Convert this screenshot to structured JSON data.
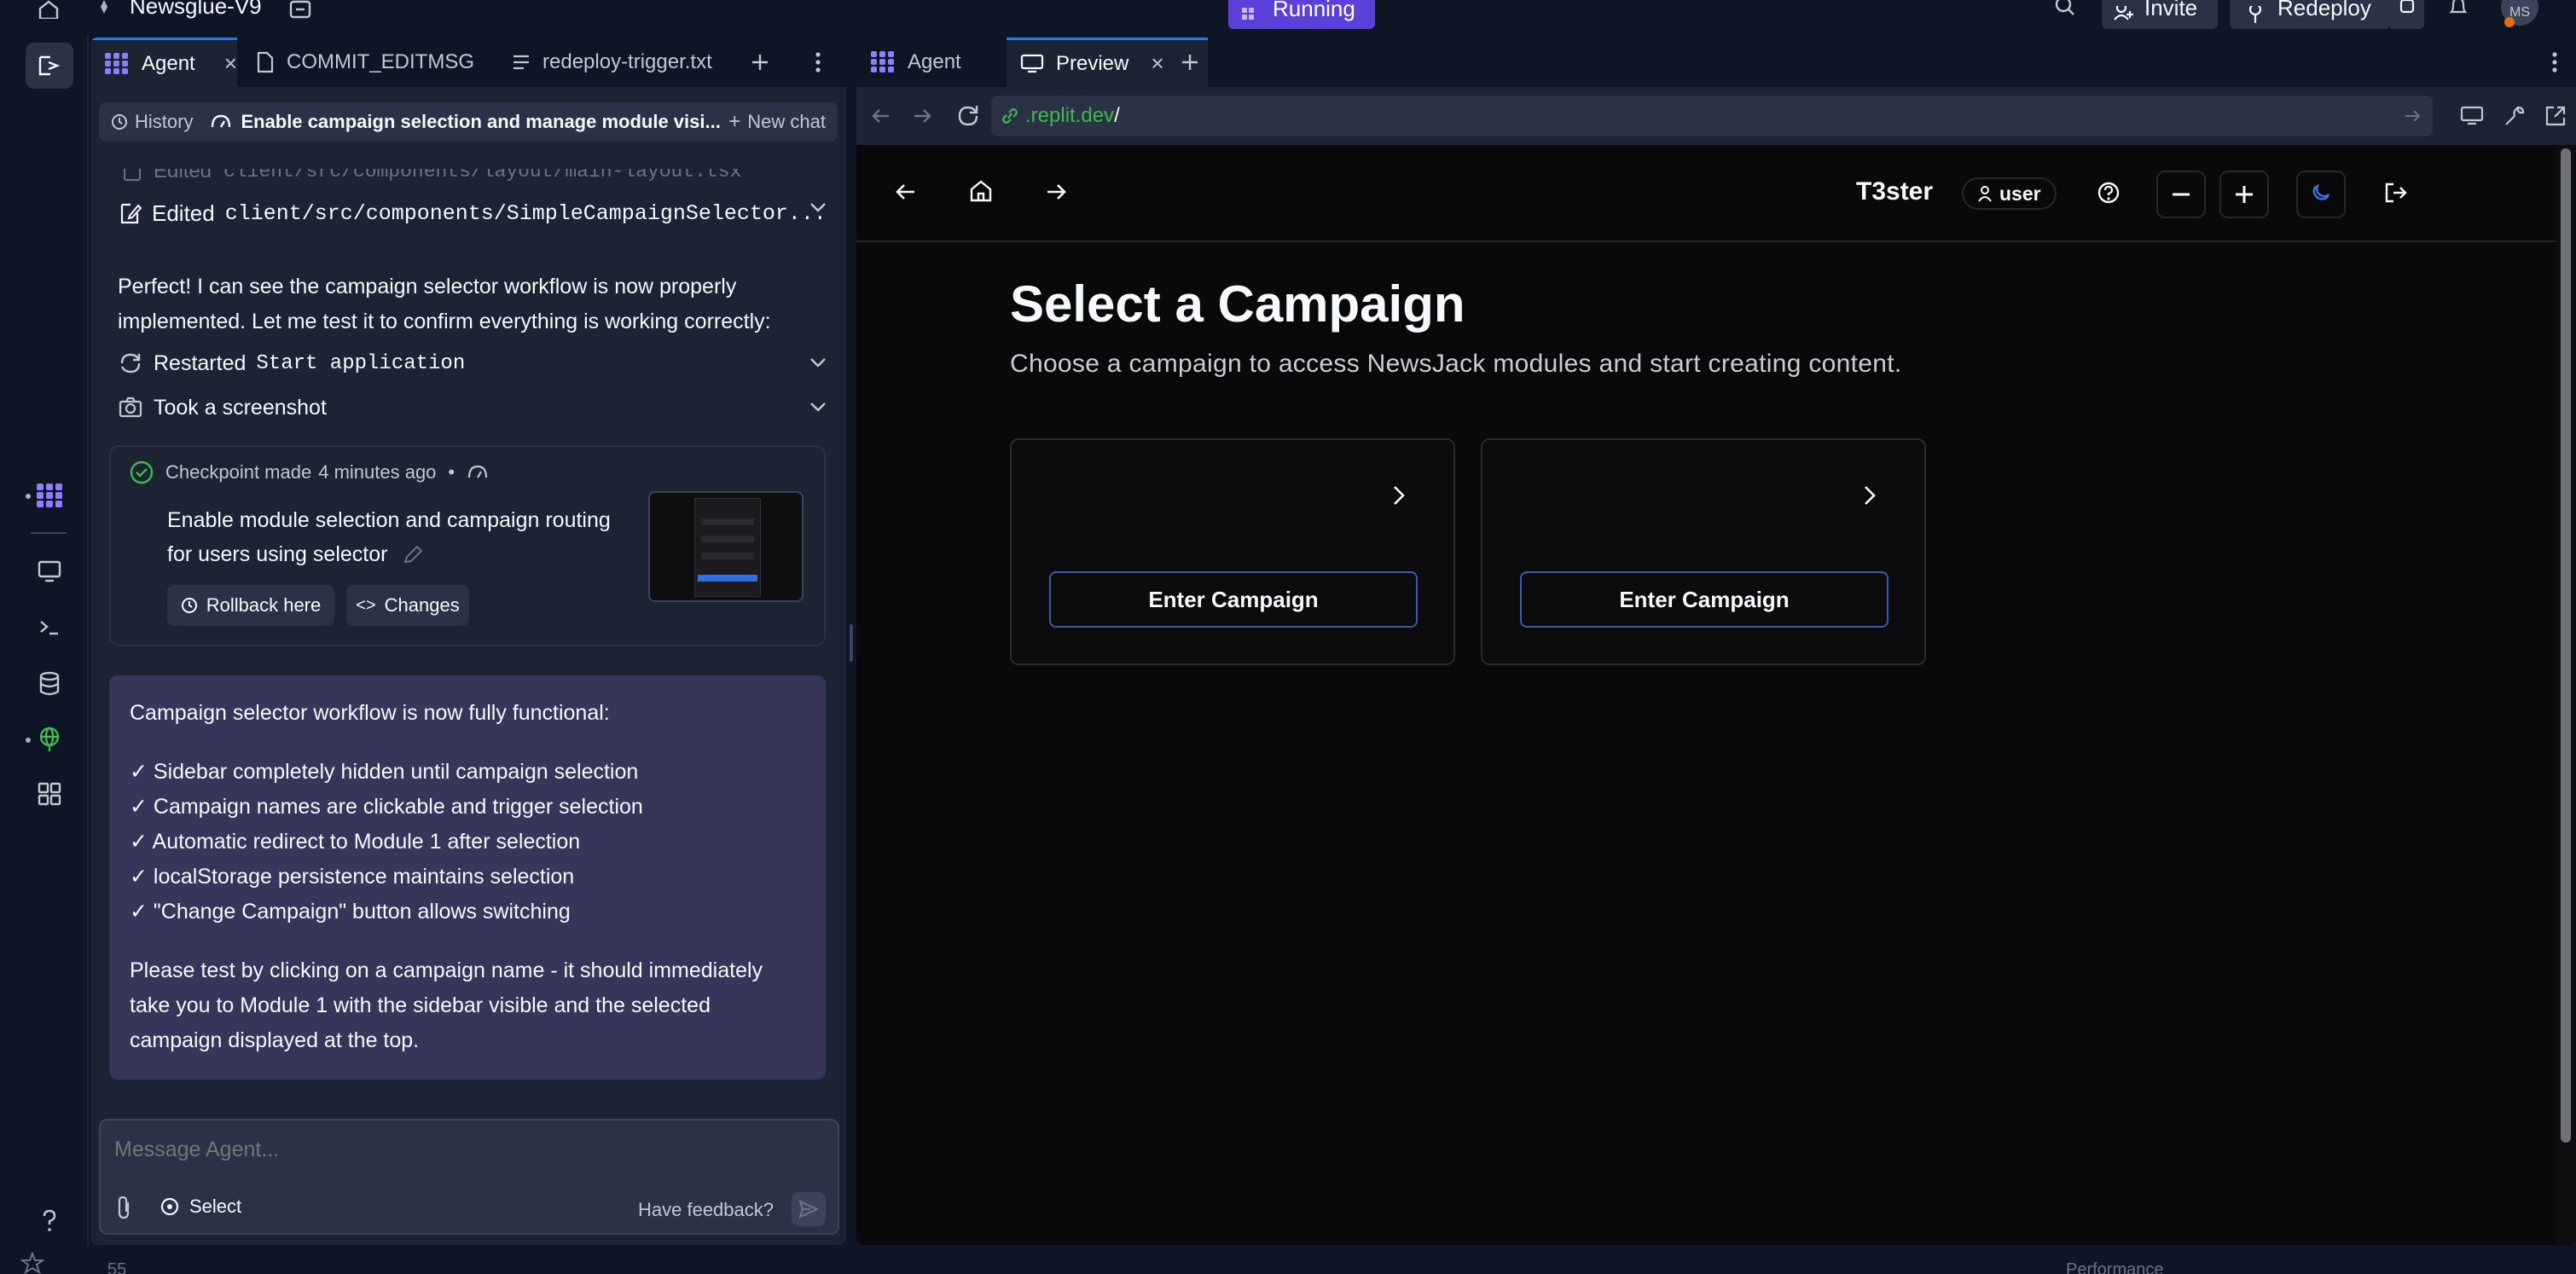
{
  "topbar": {
    "project_name": "Newsglue-V9",
    "run_status": "Running",
    "invite_label": "Invite",
    "redeploy_label": "Redeploy",
    "avatar_initials": "MS"
  },
  "left_tabs": [
    {
      "label": "Agent"
    },
    {
      "label": "COMMIT_EDITMSG"
    },
    {
      "label": "redeploy-trigger.txt"
    }
  ],
  "agent_header": {
    "history_label": "History",
    "title": "Enable campaign selection and manage module visi...",
    "new_chat_label": "New chat"
  },
  "chat": {
    "edited_1_prefix": "Edited",
    "edited_1_path": "client/src/components/layout/main-layout.tsx",
    "edited_2_prefix": "Edited",
    "edited_2_path": "client/src/components/SimpleCampaignSelector...",
    "message_1": "Perfect! I can see the campaign selector workflow is now properly implemented. Let me test it to confirm everything is working correctly:",
    "restarted_prefix": "Restarted",
    "restarted_target": "Start application",
    "screenshot_label": "Took a screenshot",
    "checkpoint": {
      "made_label": "Checkpoint made",
      "time": "4 minutes ago",
      "description": "Enable module selection and campaign routing for users using selector",
      "rollback_label": "Rollback here",
      "changes_label": "Changes"
    },
    "summary": {
      "intro": "Campaign selector workflow is now fully functional:",
      "items": [
        "✓ Sidebar completely hidden until campaign selection",
        "✓ Campaign names are clickable and trigger selection",
        "✓ Automatic redirect to Module 1 after selection",
        "✓ localStorage persistence maintains selection",
        "✓ \"Change Campaign\" button allows switching"
      ],
      "outro": "Please test by clicking on a campaign name - it should immediately take you to Module 1 with the sidebar visible and the selected campaign displayed at the top."
    }
  },
  "composer": {
    "placeholder": "Message Agent...",
    "select_label": "Select",
    "feedback_label": "Have feedback?"
  },
  "right_tabs": [
    {
      "label": "Agent"
    },
    {
      "label": "Preview"
    }
  ],
  "url_bar": {
    "host": ".replit.dev",
    "path": "/"
  },
  "preview": {
    "app_name": "T3ster",
    "user_label": "user",
    "heading": "Select a Campaign",
    "subtitle": "Choose a campaign to access NewsJack modules and start creating content.",
    "campaigns": [
      {
        "button_label": "Enter Campaign"
      },
      {
        "button_label": "Enter Campaign"
      }
    ]
  },
  "bottom": {
    "left_text": "55",
    "right_text": "Performance"
  },
  "colors": {
    "accent": "#0079f2",
    "running_bg": "#5b40d9",
    "success": "#3fb950",
    "summary_bg": "#37365a"
  }
}
